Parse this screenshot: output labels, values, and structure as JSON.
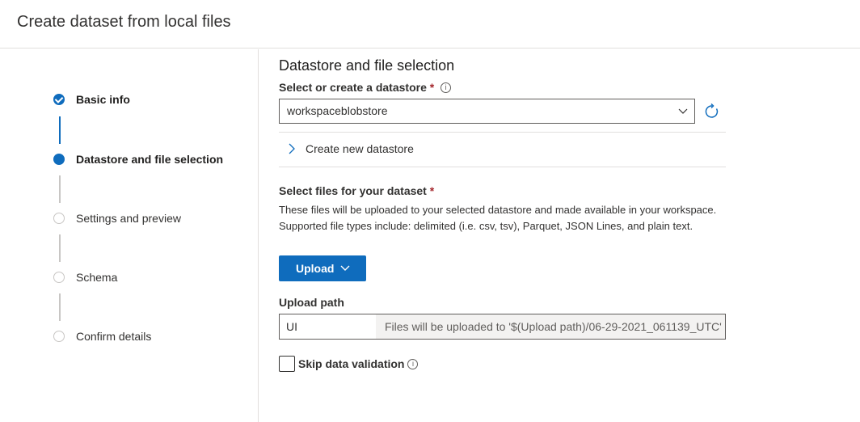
{
  "header": {
    "title": "Create dataset from local files"
  },
  "steps": [
    {
      "label": "Basic info",
      "state": "done"
    },
    {
      "label": "Datastore and file selection",
      "state": "current"
    },
    {
      "label": "Settings and preview",
      "state": "todo"
    },
    {
      "label": "Schema",
      "state": "todo"
    },
    {
      "label": "Confirm details",
      "state": "todo"
    }
  ],
  "main": {
    "section_title": "Datastore and file selection",
    "datastore": {
      "label": "Select or create a datastore",
      "required_mark": "*",
      "info_icon": "info-icon",
      "selected_value": "workspaceblobstore",
      "refresh_icon": "refresh-icon",
      "create_new_label": "Create new datastore"
    },
    "files": {
      "label": "Select files for your dataset",
      "required_mark": "*",
      "description": "These files will be uploaded to your selected datastore and made available in your workspace. Supported file types include: delimited (i.e. csv, tsv), Parquet, JSON Lines, and plain text.",
      "upload_button_label": "Upload"
    },
    "upload_path": {
      "label": "Upload path",
      "value": "UI",
      "suffix_text": "Files will be uploaded to '$(Upload path)/06-29-2021_061139_UTC'"
    },
    "skip_validation": {
      "label": "Skip data validation",
      "checked": false,
      "info_icon": "info-icon"
    }
  },
  "colors": {
    "accent": "#0f6cbd",
    "required": "#a4262c",
    "border": "#605e5c",
    "divider": "#e1dfdd"
  }
}
